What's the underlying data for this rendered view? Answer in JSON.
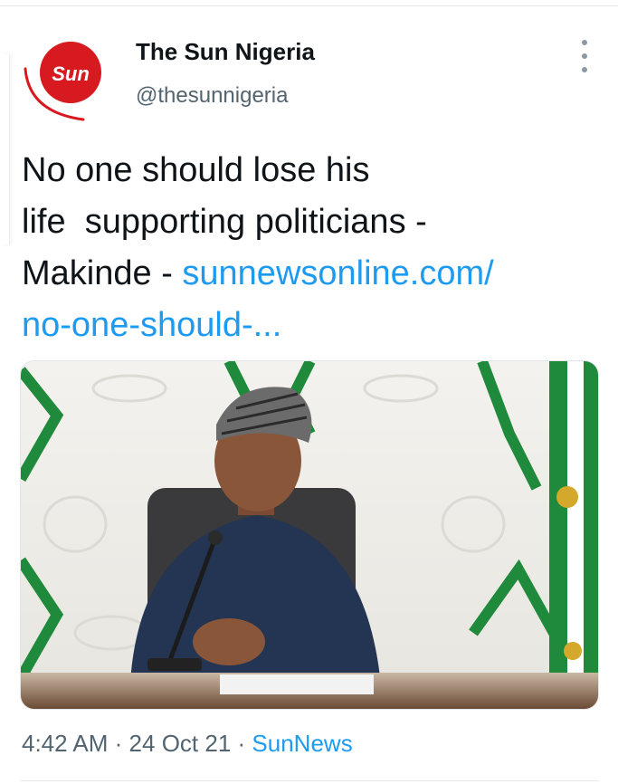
{
  "tweet": {
    "author": {
      "avatar_text": "Sun",
      "name": "The Sun Nigeria",
      "handle": "@thesunnigeria"
    },
    "text_lines": [
      "No one should lose his",
      "life  supporting politicians -",
      "Makinde - "
    ],
    "link_lines": [
      "sunnewsonline.com/",
      "no-one-should-..."
    ],
    "meta": {
      "time": "4:42 AM",
      "separator": "·",
      "date": "24 Oct 21",
      "source": "SunNews"
    }
  },
  "colors": {
    "brand_red": "#d71920",
    "link": "#1d9bf0",
    "secondary_text": "#536471",
    "flag_green": "#1f8a3b"
  },
  "icons": {
    "more": "more-vertical-icon"
  }
}
